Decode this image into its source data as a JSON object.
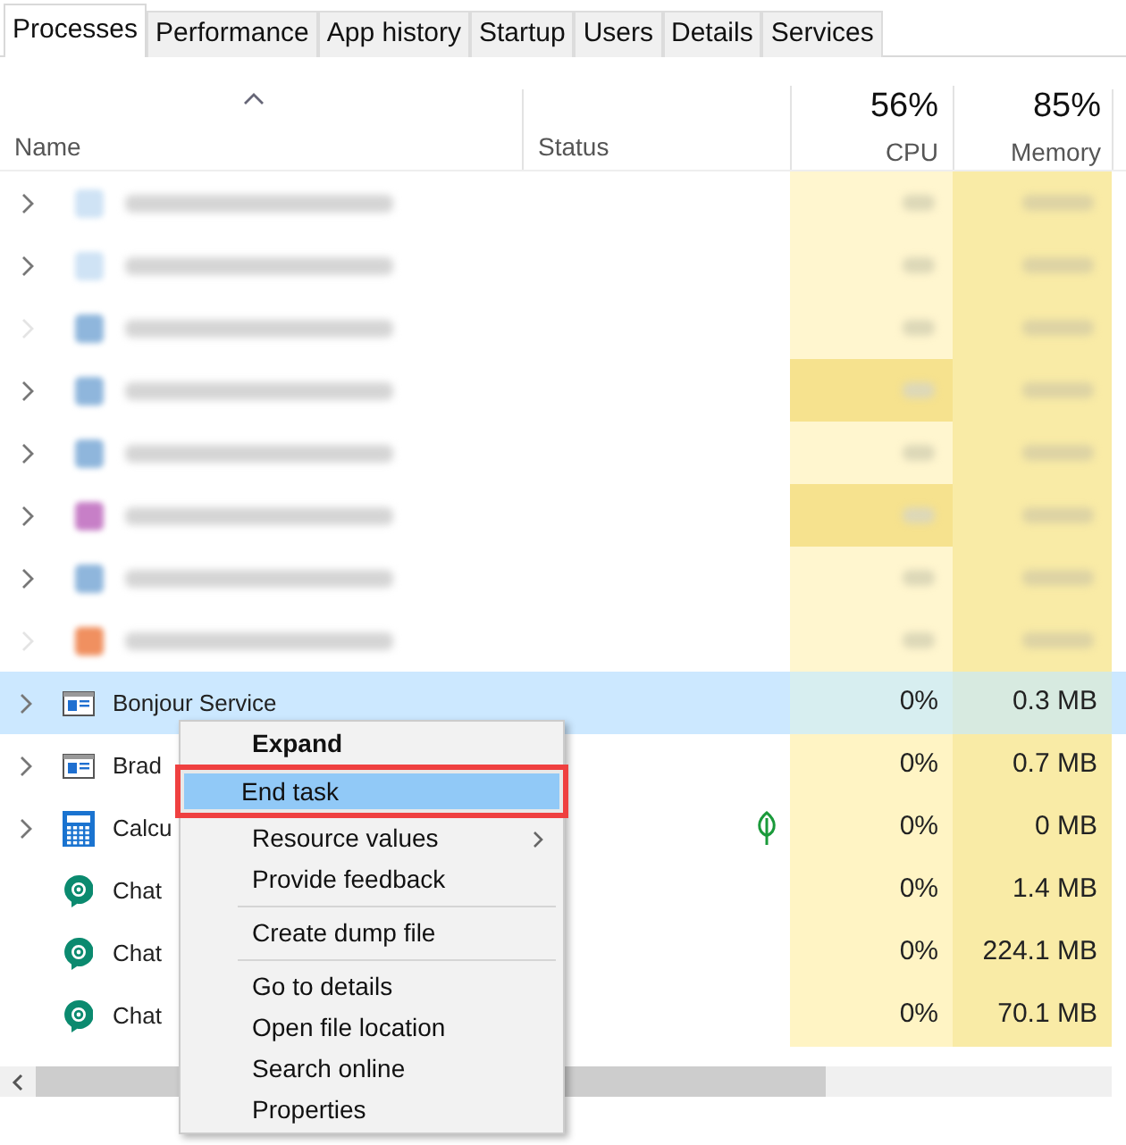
{
  "tabs": [
    {
      "label": "Processes",
      "selected": true
    },
    {
      "label": "Performance",
      "selected": false
    },
    {
      "label": "App history",
      "selected": false
    },
    {
      "label": "Startup",
      "selected": false
    },
    {
      "label": "Users",
      "selected": false
    },
    {
      "label": "Details",
      "selected": false
    },
    {
      "label": "Services",
      "selected": false
    }
  ],
  "header": {
    "name": "Name",
    "status": "Status",
    "cpu_total": "56%",
    "cpu": "CPU",
    "memory_total": "85%",
    "memory": "Memory"
  },
  "rows": [
    {
      "kind": "blurred",
      "expandable": true,
      "color": "#cfe3f5",
      "hot": false
    },
    {
      "kind": "blurred",
      "expandable": true,
      "color": "#cfe3f5",
      "hot": false
    },
    {
      "kind": "blurred",
      "expandable": false,
      "color": "#8fb6dc",
      "hot": false
    },
    {
      "kind": "blurred",
      "expandable": true,
      "color": "#8fb6dc",
      "hot": true
    },
    {
      "kind": "blurred",
      "expandable": true,
      "color": "#8fb6dc",
      "hot": false
    },
    {
      "kind": "blurred",
      "expandable": true,
      "color": "#c77fc7",
      "hot": true
    },
    {
      "kind": "blurred",
      "expandable": true,
      "color": "#8fb6dc",
      "hot": false
    },
    {
      "kind": "blurred",
      "expandable": false,
      "color": "#f09060",
      "hot": false
    },
    {
      "kind": "service",
      "name": "Bonjour Service",
      "cpu": "0%",
      "memory": "0.3 MB",
      "selected": true,
      "expandable": true,
      "leaf": false
    },
    {
      "kind": "service",
      "name": "Brad",
      "cpu": "0%",
      "memory": "0.7 MB",
      "selected": false,
      "expandable": true,
      "leaf": false
    },
    {
      "kind": "calculator",
      "name": "Calcu",
      "cpu": "0%",
      "memory": "0 MB",
      "selected": false,
      "expandable": true,
      "leaf": true
    },
    {
      "kind": "chat",
      "name": "Chat",
      "cpu": "0%",
      "memory": "1.4 MB",
      "selected": false,
      "expandable": false,
      "leaf": false
    },
    {
      "kind": "chat",
      "name": "Chat",
      "cpu": "0%",
      "memory": "224.1 MB",
      "selected": false,
      "expandable": false,
      "leaf": false
    },
    {
      "kind": "chat",
      "name": "Chat",
      "cpu": "0%",
      "memory": "70.1 MB",
      "selected": false,
      "expandable": false,
      "leaf": false
    }
  ],
  "context_menu": [
    {
      "kind": "item",
      "label": "Expand",
      "bold": true,
      "highlighted": false,
      "submenu": false
    },
    {
      "kind": "item",
      "label": "End task",
      "bold": false,
      "highlighted": true,
      "submenu": false
    },
    {
      "kind": "item",
      "label": "Resource values",
      "bold": false,
      "highlighted": false,
      "submenu": true
    },
    {
      "kind": "item",
      "label": "Provide feedback",
      "bold": false,
      "highlighted": false,
      "submenu": false
    },
    {
      "kind": "separator"
    },
    {
      "kind": "item",
      "label": "Create dump file",
      "bold": false,
      "highlighted": false,
      "submenu": false
    },
    {
      "kind": "separator"
    },
    {
      "kind": "item",
      "label": "Go to details",
      "bold": false,
      "highlighted": false,
      "submenu": false
    },
    {
      "kind": "item",
      "label": "Open file location",
      "bold": false,
      "highlighted": false,
      "submenu": false
    },
    {
      "kind": "item",
      "label": "Search online",
      "bold": false,
      "highlighted": false,
      "submenu": false
    },
    {
      "kind": "item",
      "label": "Properties",
      "bold": false,
      "highlighted": false,
      "submenu": false
    }
  ]
}
